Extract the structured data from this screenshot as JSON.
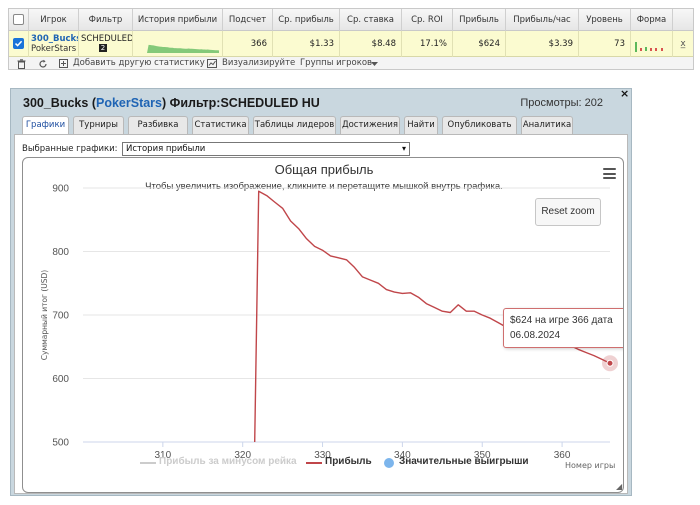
{
  "top_table": {
    "headers": [
      "Игрок",
      "Фильтр",
      "История прибыли",
      "Подсчет",
      "Ср. прибыль",
      "Ср. ставка",
      "Ср. ROI",
      "Прибыль",
      "Прибыль/час",
      "Уровень",
      "Форма"
    ],
    "row": {
      "player": "300_Bucks",
      "site": "PokerStars",
      "filter": "SCHEDULED",
      "filter_badge": "2",
      "count": "366",
      "avg_profit": "$1.33",
      "avg_stake": "$8.48",
      "avg_roi": "17.1%",
      "profit": "$624",
      "profit_per_hour": "$3.39",
      "level": "73"
    },
    "toolbar": {
      "add_stat": "Добавить другую статистику",
      "visualize": "Визуализируйте",
      "player_groups": "Группы игроков"
    }
  },
  "dialog": {
    "title_player": "300_Bucks",
    "title_open": "(",
    "title_site": "PokerStars",
    "title_close": ")",
    "title_filter": "Фильтр:SCHEDULED HU",
    "views": "Просмотры: 202",
    "close": "×",
    "tabs": [
      "Графики",
      "Турниры",
      "Разбивка",
      "Статистика",
      "Таблицы лидеров",
      "Достижения",
      "Найти",
      "Опубликовать",
      "Аналитика"
    ],
    "active_tab": 0,
    "select_label": "Выбранные графики:",
    "select_value": "История прибыли"
  },
  "colors": {
    "accent": "#1f64b4",
    "line": "#c0464a",
    "row_highlight": "#fbfbd0",
    "dialog_bg": "#c9d7df",
    "legend_blue": "#7cb5ec"
  },
  "icons": [
    "trash-icon",
    "refresh-icon",
    "add-stat-icon",
    "chart-icon",
    "menu-icon",
    "dropdown-arrow-icon",
    "close-icon",
    "resize-grip-icon"
  ],
  "chart_data": {
    "type": "line",
    "title": "Общая прибыль",
    "subtitle": "Чтобы увеличить изображение, кликните и перетащите мышкой внутрь графика.",
    "ylabel": "Суммарный итог (USD)",
    "xlabel": "Номер игры",
    "xlim": [
      300,
      366
    ],
    "ylim": [
      500,
      900
    ],
    "x_ticks": [
      310,
      320,
      330,
      340,
      350,
      360
    ],
    "y_ticks": [
      500,
      600,
      700,
      800,
      900
    ],
    "reset_zoom": "Reset zoom",
    "tooltip": {
      "line1": "$624 на игре 366 дата",
      "line2": "06.08.2024"
    },
    "legend": [
      {
        "name": "Прибыль за минусом рейка",
        "color": "#cccccc",
        "visible": false
      },
      {
        "name": "Прибыль",
        "color": "#c0464a",
        "visible": true
      },
      {
        "name": "Значительные выигрыши",
        "color": "#7cb5ec",
        "visible": true
      }
    ],
    "series": [
      {
        "name": "Прибыль",
        "x": [
          321.5,
          322,
          323,
          324,
          325,
          326,
          327,
          328,
          329,
          330,
          331,
          332,
          333,
          334,
          335,
          336,
          337,
          338,
          339,
          340,
          341,
          342,
          343,
          344,
          345,
          346,
          347,
          348,
          349,
          350,
          351,
          352,
          353,
          354,
          355,
          356,
          357,
          358,
          359,
          360,
          361,
          362,
          363,
          364,
          365,
          366
        ],
        "y": [
          500,
          895,
          888,
          878,
          868,
          848,
          836,
          820,
          808,
          802,
          793,
          790,
          787,
          775,
          760,
          755,
          750,
          740,
          736,
          734,
          735,
          728,
          718,
          712,
          706,
          704,
          716,
          706,
          706,
          700,
          695,
          688,
          681,
          674,
          678,
          668,
          672,
          664,
          668,
          658,
          652,
          646,
          641,
          636,
          630,
          624
        ]
      }
    ],
    "highlight_point": {
      "x": 366,
      "y": 624
    }
  }
}
